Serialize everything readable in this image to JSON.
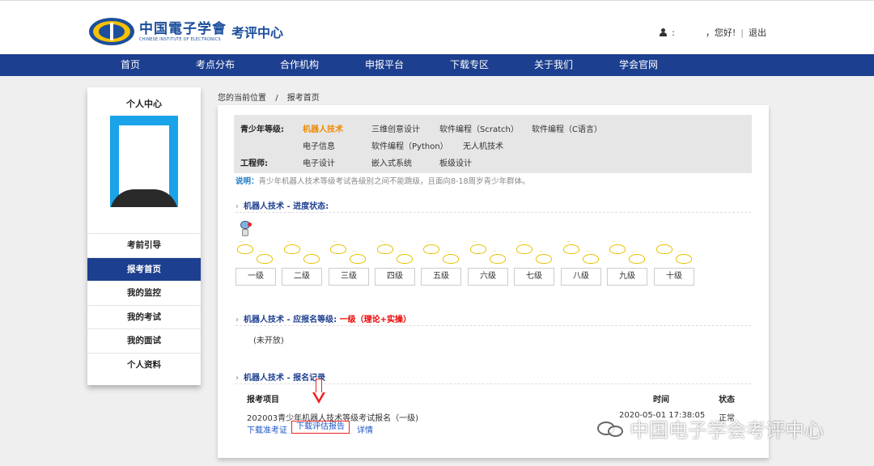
{
  "header": {
    "logo_cn": "中国電子学會",
    "logo_en": "CHINESE INSTITUTE OF ELECTRONICS",
    "logo_sub": "考评中心",
    "user_colon": ":",
    "greeting": "，您好!",
    "separator": "|",
    "logout": "退出"
  },
  "nav": {
    "items": [
      "首页",
      "考点分布",
      "合作机构",
      "申报平台",
      "下载专区",
      "关于我们",
      "学会官网"
    ]
  },
  "sidebar": {
    "title": "个人中心",
    "items": [
      "考前引导",
      "报考首页",
      "我的监控",
      "我的考试",
      "我的面试",
      "个人资料"
    ],
    "active_index": 1
  },
  "breadcrumb": {
    "prefix": "您的当前位置",
    "separator": "/",
    "current": "报考首页"
  },
  "categories": {
    "youth_label": "青少年等级:",
    "youth_row1": [
      "机器人技术",
      "三维创意设计",
      "软件编程（Scratch）",
      "软件编程（C语言）"
    ],
    "youth_row2": [
      "电子信息",
      "软件编程（Python）",
      "无人机技术"
    ],
    "engineer_label": "工程师:",
    "engineer_row": [
      "电子设计",
      "嵌入式系统",
      "板级设计"
    ],
    "active": "机器人技术"
  },
  "note": {
    "label": "说明：",
    "text": "青少年机器人技术等级考试各级别之间不能跳级，且面向8-18周岁青少年群体。"
  },
  "progress": {
    "title": "机器人技术 - 进度状态:",
    "levels": [
      "一级",
      "二级",
      "三级",
      "四级",
      "五级",
      "六级",
      "七级",
      "八级",
      "九级",
      "十级"
    ]
  },
  "eligible": {
    "title": "机器人技术 - 应报名等级:",
    "level": "一级（理论+实操）",
    "status": "(未开放)"
  },
  "records": {
    "title": "机器人技术 - 报名记录",
    "headers": {
      "item": "报考项目",
      "time": "时间",
      "status": "状态"
    },
    "rows": [
      {
        "item": "202003青少年机器人技术等级考试报名（一级)",
        "time": "2020-05-01 17:38:05",
        "status": "正常",
        "link_ticket": "下载准考证",
        "link_report": "下载评估报告",
        "link_detail": "详情"
      }
    ]
  },
  "watermark": "中国电子学会考评中心",
  "colors": {
    "nav": "#1d3f8f",
    "accent_orange": "#f08a00",
    "highlight_red": "#e22"
  }
}
